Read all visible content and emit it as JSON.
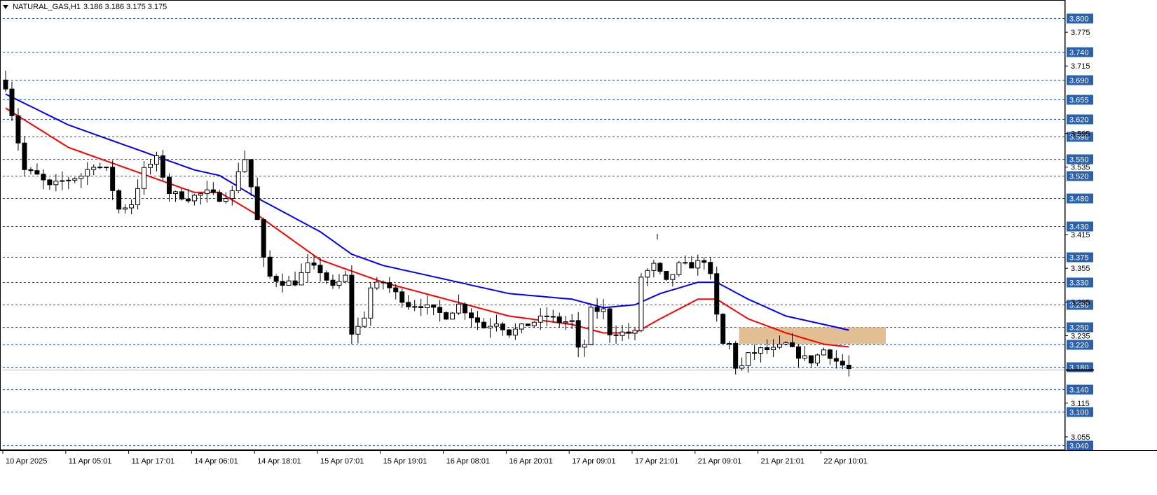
{
  "header": {
    "symbol": "NATURAL_GAS,H1",
    "ohlc": "3.186 3.186 3.175 3.175"
  },
  "colors": {
    "bull_candle": "#ffffff",
    "bear_candle": "#000000",
    "ma_fast": "#ff0000",
    "ma_slow": "#0000ff",
    "level_line": "#2a55aa",
    "level_label_bg": "#2b62ad",
    "zone": "#deb887"
  },
  "chart_data": {
    "type": "candlestick",
    "title": "NATURAL_GAS,H1",
    "ylim": [
      3.035,
      3.81
    ],
    "bar_count": 135,
    "levels": [
      3.8,
      3.74,
      3.69,
      3.655,
      3.62,
      3.59,
      3.55,
      3.52,
      3.48,
      3.43,
      3.375,
      3.33,
      3.29,
      3.25,
      3.22,
      3.18,
      3.14,
      3.1,
      3.04
    ],
    "y_ticks": [
      3.775,
      3.715,
      3.595,
      3.535,
      3.415,
      3.355,
      3.295,
      3.235,
      3.115,
      3.055
    ],
    "x_labels": [
      {
        "bar": 0,
        "label": "10 Apr 2025"
      },
      {
        "bar": 10,
        "label": "11 Apr 05:01"
      },
      {
        "bar": 20,
        "label": "11 Apr 17:01"
      },
      {
        "bar": 30,
        "label": "14 Apr 06:01"
      },
      {
        "bar": 40,
        "label": "14 Apr 18:01"
      },
      {
        "bar": 50,
        "label": "15 Apr 07:01"
      },
      {
        "bar": 60,
        "label": "15 Apr 19:01"
      },
      {
        "bar": 70,
        "label": "16 Apr 08:01"
      },
      {
        "bar": 80,
        "label": "16 Apr 20:01"
      },
      {
        "bar": 90,
        "label": "17 Apr 09:01"
      },
      {
        "bar": 100,
        "label": "17 Apr 21:01"
      },
      {
        "bar": 110,
        "label": "21 Apr 09:01"
      },
      {
        "bar": 120,
        "label": "21 Apr 21:01"
      },
      {
        "bar": 130,
        "label": "22 Apr 10:01"
      }
    ],
    "current_price": 3.175,
    "zone": {
      "from_bar": 117,
      "to_bar": 140,
      "top": 3.25,
      "bottom": 3.22
    },
    "close_anchors": [
      [
        0,
        3.68
      ],
      [
        1,
        3.63
      ],
      [
        2,
        3.58
      ],
      [
        3,
        3.53
      ],
      [
        5,
        3.52
      ],
      [
        7,
        3.5
      ],
      [
        9,
        3.51
      ],
      [
        12,
        3.52
      ],
      [
        14,
        3.54
      ],
      [
        16,
        3.53
      ],
      [
        18,
        3.46
      ],
      [
        20,
        3.47
      ],
      [
        22,
        3.53
      ],
      [
        24,
        3.55
      ],
      [
        26,
        3.49
      ],
      [
        29,
        3.48
      ],
      [
        32,
        3.49
      ],
      [
        34,
        3.48
      ],
      [
        36,
        3.49
      ],
      [
        37,
        3.53
      ],
      [
        38,
        3.55
      ],
      [
        39,
        3.5
      ],
      [
        40,
        3.44
      ],
      [
        41,
        3.37
      ],
      [
        42,
        3.34
      ],
      [
        44,
        3.33
      ],
      [
        46,
        3.33
      ],
      [
        48,
        3.36
      ],
      [
        50,
        3.35
      ],
      [
        52,
        3.32
      ],
      [
        54,
        3.34
      ],
      [
        55,
        3.24
      ],
      [
        56,
        3.25
      ],
      [
        57,
        3.27
      ],
      [
        58,
        3.32
      ],
      [
        60,
        3.33
      ],
      [
        62,
        3.31
      ],
      [
        64,
        3.29
      ],
      [
        66,
        3.29
      ],
      [
        68,
        3.28
      ],
      [
        70,
        3.27
      ],
      [
        72,
        3.29
      ],
      [
        74,
        3.27
      ],
      [
        76,
        3.25
      ],
      [
        78,
        3.26
      ],
      [
        80,
        3.24
      ],
      [
        82,
        3.25
      ],
      [
        84,
        3.26
      ],
      [
        86,
        3.27
      ],
      [
        88,
        3.26
      ],
      [
        90,
        3.26
      ],
      [
        91,
        3.21
      ],
      [
        92,
        3.22
      ],
      [
        93,
        3.28
      ],
      [
        95,
        3.28
      ],
      [
        96,
        3.24
      ],
      [
        98,
        3.24
      ],
      [
        100,
        3.24
      ],
      [
        101,
        3.34
      ],
      [
        103,
        3.36
      ],
      [
        105,
        3.33
      ],
      [
        107,
        3.36
      ],
      [
        109,
        3.36
      ],
      [
        111,
        3.37
      ],
      [
        112,
        3.34
      ],
      [
        113,
        3.27
      ],
      [
        114,
        3.22
      ],
      [
        115,
        3.22
      ],
      [
        116,
        3.18
      ],
      [
        117,
        3.18
      ],
      [
        118,
        3.2
      ],
      [
        120,
        3.21
      ],
      [
        122,
        3.21
      ],
      [
        124,
        3.22
      ],
      [
        126,
        3.2
      ],
      [
        128,
        3.19
      ],
      [
        130,
        3.21
      ],
      [
        132,
        3.19
      ],
      [
        134,
        3.175
      ]
    ],
    "ma_fast_anchors": [
      [
        0,
        3.64
      ],
      [
        10,
        3.57
      ],
      [
        20,
        3.53
      ],
      [
        30,
        3.49
      ],
      [
        34,
        3.49
      ],
      [
        40,
        3.45
      ],
      [
        50,
        3.37
      ],
      [
        60,
        3.33
      ],
      [
        70,
        3.3
      ],
      [
        80,
        3.27
      ],
      [
        90,
        3.255
      ],
      [
        95,
        3.24
      ],
      [
        100,
        3.24
      ],
      [
        104,
        3.265
      ],
      [
        110,
        3.3
      ],
      [
        113,
        3.3
      ],
      [
        118,
        3.265
      ],
      [
        124,
        3.24
      ],
      [
        130,
        3.22
      ],
      [
        134,
        3.215
      ]
    ],
    "ma_slow_anchors": [
      [
        0,
        3.665
      ],
      [
        10,
        3.61
      ],
      [
        20,
        3.57
      ],
      [
        30,
        3.53
      ],
      [
        34,
        3.52
      ],
      [
        40,
        3.48
      ],
      [
        50,
        3.42
      ],
      [
        55,
        3.38
      ],
      [
        60,
        3.36
      ],
      [
        70,
        3.335
      ],
      [
        80,
        3.31
      ],
      [
        90,
        3.3
      ],
      [
        95,
        3.285
      ],
      [
        100,
        3.29
      ],
      [
        104,
        3.31
      ],
      [
        110,
        3.33
      ],
      [
        113,
        3.33
      ],
      [
        118,
        3.3
      ],
      [
        124,
        3.27
      ],
      [
        130,
        3.255
      ],
      [
        134,
        3.245
      ]
    ]
  }
}
